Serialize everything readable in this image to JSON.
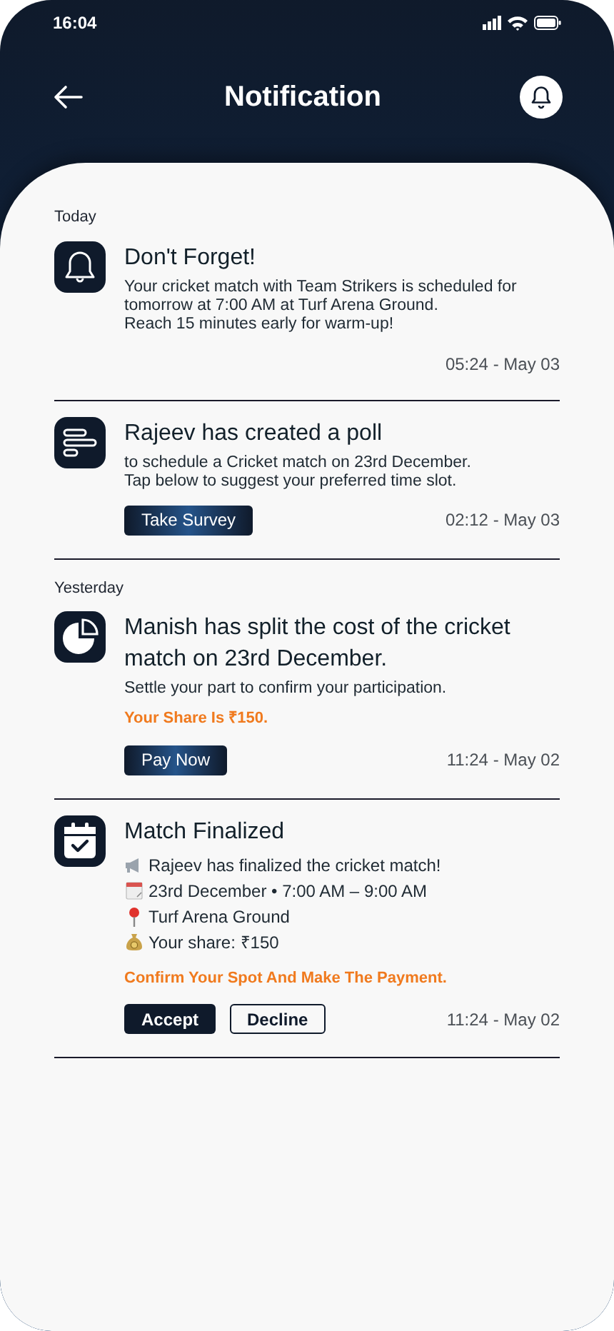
{
  "status_bar": {
    "time": "16:04"
  },
  "header": {
    "title": "Notification"
  },
  "sections": [
    {
      "label": "Today",
      "notifications": [
        {
          "kind": "reminder",
          "title": "Don't Forget!",
          "lines": [
            "Your cricket match with Team Strikers is scheduled for tomorrow at 7:00 AM at Turf Arena Ground.",
            "Reach 15 minutes early for warm-up!"
          ],
          "time": "05:24 - May 03"
        },
        {
          "kind": "poll",
          "title": "Rajeev has created a poll",
          "lines": [
            "to schedule a Cricket match on 23rd December.",
            "Tap below to suggest your preferred time slot."
          ],
          "actions": [
            {
              "label": "Take Survey",
              "kind": "gradient"
            }
          ],
          "time": "02:12 - May 03"
        }
      ]
    },
    {
      "label": "Yesterday",
      "notifications": [
        {
          "kind": "split",
          "title": "Manish has split the cost of the cricket match on 23rd December.",
          "lines": [
            "Settle your part to confirm your participation."
          ],
          "highlight": "Your Share Is ₹150.",
          "actions": [
            {
              "label": "Pay Now",
              "kind": "gradient"
            }
          ],
          "time": "11:24 - May 02"
        },
        {
          "kind": "finalized",
          "title": "Match Finalized",
          "lines": [
            "Rajeev has finalized the cricket match!",
            "23rd December • 7:00 AM – 9:00 AM",
            "Turf Arena Ground",
            "Your share: ₹150"
          ],
          "highlight": "Confirm Your Spot And Make The Payment.",
          "actions": [
            {
              "label": "Accept",
              "kind": "solid"
            },
            {
              "label": "Decline",
              "kind": "outline"
            }
          ],
          "time": "11:24 - May 02"
        }
      ]
    }
  ]
}
